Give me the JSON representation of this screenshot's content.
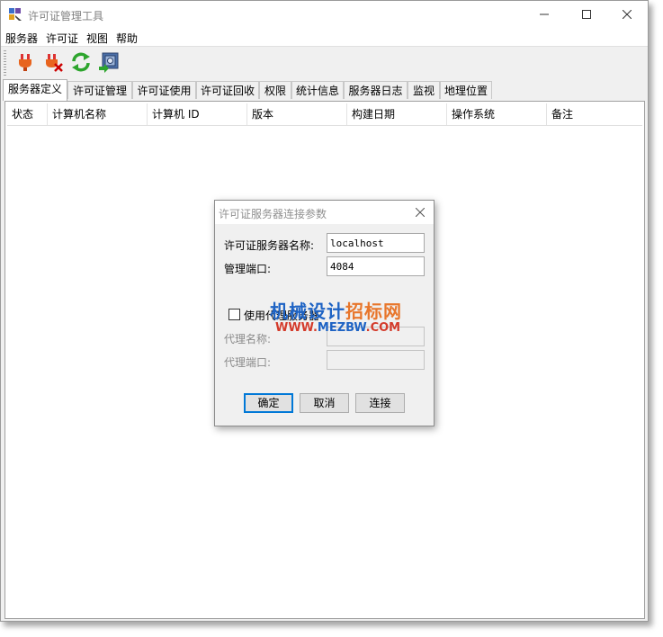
{
  "window": {
    "title": "许可证管理工具",
    "controls": [
      "minimize-icon",
      "maximize-icon",
      "close-icon"
    ]
  },
  "menu": [
    "服务器",
    "许可证",
    "视图",
    "帮助"
  ],
  "toolbar": {
    "icons": [
      "power-plug-icon",
      "plug-disconnect-icon",
      "refresh-icon",
      "server-export-icon"
    ]
  },
  "tabs": [
    "服务器定义",
    "许可证管理",
    "许可证使用",
    "许可证回收",
    "权限",
    "统计信息",
    "服务器日志",
    "监视",
    "地理位置"
  ],
  "active_tab": "服务器定义",
  "table": {
    "columns": [
      "状态",
      "计算机名称",
      "计算机 ID",
      "版本",
      "构建日期",
      "操作系统",
      "备注"
    ],
    "rows": []
  },
  "dialog": {
    "title": "许可证服务器连接参数",
    "server_name_label": "许可证服务器名称:",
    "server_name_value": "localhost",
    "port_label": "管理端口:",
    "port_value": "4084",
    "proxy_checkbox_label": "使用代理服务器",
    "proxy_checked": false,
    "proxy_name_label": "代理名称:",
    "proxy_name_value": "",
    "proxy_port_label": "代理端口:",
    "proxy_port_value": "",
    "ok_label": "确定",
    "cancel_label": "取消",
    "connect_label": "连接"
  },
  "watermark": {
    "text_blue": "机械设计",
    "text_orange": "招标网",
    "url_red_1": "WWW.",
    "url_blue": "MEZBW",
    "url_red_2": ".COM"
  },
  "colors": {
    "accent": "#0078d7",
    "watermark_blue": "#1e63c4",
    "watermark_orange": "#e8762b",
    "watermark_red": "#d43b2b"
  }
}
